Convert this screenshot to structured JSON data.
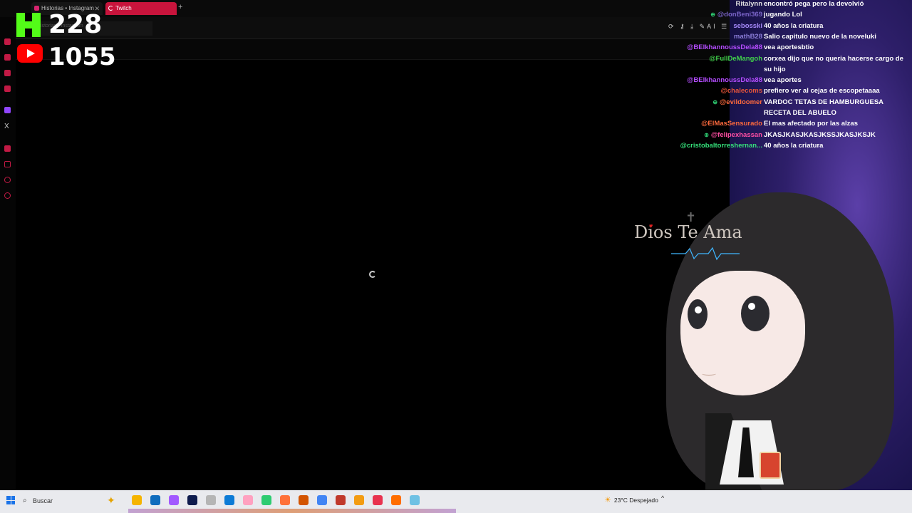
{
  "browser": {
    "tabs": [
      {
        "label": "Historias • Instagram",
        "favicon": "instagram-icon",
        "color": "#d6246e"
      },
      {
        "label": "Twitch",
        "favicon": "loading-icon",
        "color": "#c8143c",
        "active": true
      }
    ],
    "close_glyph": "✕",
    "new_tab_glyph": "+",
    "suggestion_text": "Historias • Instagram",
    "toolbar_icons_text": "⟳ ⚷ ⤓ ✎AI ☰"
  },
  "stream_counters": {
    "kick": {
      "value": "228",
      "icon": "kick-logo",
      "color": "#53fc18"
    },
    "youtube": {
      "value": "1055",
      "icon": "youtube-logo",
      "color": "#ff0000"
    }
  },
  "sidebar": {
    "x_glyph": "X"
  },
  "overlay": {
    "text": "Dios Te Ama",
    "heart": "♥",
    "cross": "✝"
  },
  "chat": [
    {
      "user": "Ritalynn",
      "message": "encontró pega pero la devolvió",
      "color": "#e0e0e0",
      "badge": false
    },
    {
      "user": "@donBeni369",
      "message": "jugando Lol",
      "color": "#7a64c8",
      "badge": true
    },
    {
      "user": "sebosski",
      "message": "40 años la criatura",
      "color": "#a78bfa",
      "badge": false
    },
    {
      "user": "mathB28",
      "message": "Salio capitulo nuevo de la noveluki",
      "color": "#8b7dd8",
      "badge": false
    },
    {
      "user": "@BElkhannoussDela88",
      "message": "vea aportesbtio",
      "color": "#b44dff",
      "badge": false
    },
    {
      "user": "@FullDeMangoh",
      "message": "corxea dijo que no queria hacerse cargo de su hijo",
      "color": "#41d24b",
      "badge": false
    },
    {
      "user": "@BElkhannoussDela88",
      "message": "vea aportes",
      "color": "#b44dff",
      "badge": false
    },
    {
      "user": "@chalecoms",
      "message": "prefiero ver al cejas de escopetaaaa",
      "color": "#e8553a",
      "badge": false
    },
    {
      "user": "@evildoomer",
      "message": "VARDOC TETAS DE HAMBURGUESA RECETA DEL ABUELO",
      "color": "#ff6a3d",
      "badge": true
    },
    {
      "user": "@ElMasSensurado",
      "message": "El mas afectado por las alzas",
      "color": "#ff6a3d",
      "badge": false
    },
    {
      "user": "@felipexhassan",
      "message": "JKASJKASJKASJKSSJKASJKSJK",
      "color": "#ff4fa3",
      "badge": true
    },
    {
      "user": "@cristobaltorreshernan...",
      "message": "40 años la criatura",
      "color": "#35e07a",
      "badge": false
    }
  ],
  "taskbar": {
    "search_placeholder": "Buscar",
    "weather": "23°C Despejado",
    "apps": [
      "sparkle-icon",
      "task-view-icon",
      "file-explorer-icon",
      "edge-copilot-icon",
      "visual-studio-icon",
      "app-icon",
      "edge-icon",
      "app-icon-2",
      "paint-icon",
      "firefox-icon",
      "vscode-icon",
      "chrome-icon",
      "app-icon-3",
      "java-icon",
      "opera-icon",
      "app-icon-4",
      "notepad-icon"
    ],
    "glyphs": {
      "start": "",
      "search": "⌕",
      "sparkle": "✦",
      "sun": "☀",
      "chevron": "^"
    }
  }
}
